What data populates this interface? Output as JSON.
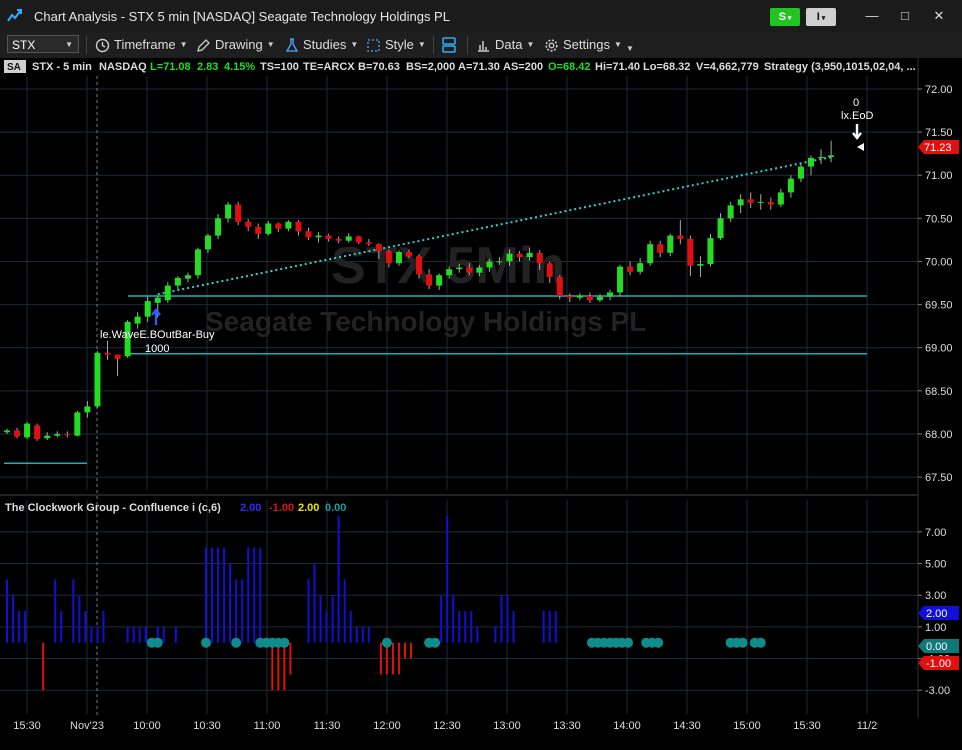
{
  "window": {
    "title": "Chart Analysis - STX 5 min [NASDAQ] Seagate Technology Holdings PL",
    "s_button": "S",
    "i_button": "I",
    "minimize": "—",
    "maximize": "□",
    "close": "✕"
  },
  "toolbar": {
    "symbol": "STX",
    "timeframe": "Timeframe",
    "drawing": "Drawing",
    "studies": "Studies",
    "style": "Style",
    "data": "Data",
    "settings": "Settings"
  },
  "status": {
    "badge": "SA",
    "symbol": "STX - 5 min",
    "exchange": "NASDAQ",
    "last": "L=71.08",
    "change": "2.83",
    "pct": "4.15%",
    "ts": "TS=100",
    "te": "TE=ARCX",
    "bid": "B=70.63",
    "bs": "BS=2,000",
    "ask": "A=71.30",
    "as": "AS=200",
    "open": "O=68.42",
    "high": "Hi=71.40",
    "low": "Lo=68.32",
    "volume": "V=4,662,779",
    "strategy": "Strategy (3,950,1015,02,04, ..."
  },
  "watermark": {
    "line1": "STX 5Min",
    "line2": "Seagate Technology Holdings PL"
  },
  "annotations": {
    "entry_label": "le.WaveE.BOutBar-Buy",
    "entry_qty": "1000",
    "exit_label": "lx.EoD",
    "exit_qty": "0",
    "last_price": "71.23"
  },
  "indicator": {
    "title": "The Clockwork Group - Confluence i (c,6)",
    "v1": "2.00",
    "v2": "-1.00",
    "v3": "2.00",
    "v4": "0.00",
    "tag_blue": "2.00",
    "tag_teal": "0.00",
    "tag_red": "-1.00"
  },
  "colors": {
    "up": "#22dd22",
    "down": "#e01010",
    "pos_bar": "#1010d8",
    "neg_bar": "#e01010",
    "dot": "#0f8c8c",
    "trendline": "#30d0d0",
    "hline": "#20b0b0"
  },
  "chart_data": [
    {
      "type": "candlestick",
      "yticks": [
        "72.00",
        "71.50",
        "71.00",
        "70.50",
        "70.00",
        "69.50",
        "69.00",
        "68.50",
        "68.00",
        "67.50"
      ],
      "ylim": [
        67.35,
        72.15
      ],
      "xticks": [
        "15:30",
        "Nov'23",
        "10:00",
        "10:30",
        "11:00",
        "11:30",
        "12:00",
        "12:30",
        "13:00",
        "13:30",
        "14:00",
        "14:30",
        "15:00",
        "15:30",
        "11/2"
      ],
      "candles": [
        [
          68.02,
          68.04,
          68.0,
          68.06
        ],
        [
          68.04,
          67.97,
          67.95,
          68.07
        ],
        [
          67.96,
          68.12,
          67.94,
          68.14
        ],
        [
          68.1,
          67.94,
          67.92,
          68.12
        ],
        [
          67.95,
          67.98,
          67.93,
          68.02
        ],
        [
          67.98,
          68.0,
          67.96,
          68.03
        ],
        [
          68.0,
          67.99,
          67.96,
          68.03
        ],
        [
          67.98,
          68.25,
          67.97,
          68.27
        ],
        [
          68.25,
          68.32,
          68.19,
          68.38
        ],
        [
          68.32,
          68.94,
          68.3,
          68.96
        ],
        [
          68.94,
          68.92,
          68.86,
          69.08
        ],
        [
          68.92,
          68.87,
          68.67,
          68.92
        ],
        [
          68.9,
          69.3,
          68.88,
          69.32
        ],
        [
          69.28,
          69.36,
          69.22,
          69.41
        ],
        [
          69.36,
          69.54,
          69.3,
          69.59
        ],
        [
          69.52,
          69.58,
          69.35,
          69.6
        ],
        [
          69.55,
          69.72,
          69.52,
          69.76
        ],
        [
          69.72,
          69.81,
          69.68,
          69.83
        ],
        [
          69.8,
          69.84,
          69.76,
          69.87
        ],
        [
          69.84,
          70.14,
          69.8,
          70.16
        ],
        [
          70.14,
          70.3,
          70.1,
          70.32
        ],
        [
          70.3,
          70.5,
          70.26,
          70.55
        ],
        [
          70.5,
          70.66,
          70.45,
          70.69
        ],
        [
          70.66,
          70.46,
          70.42,
          70.69
        ],
        [
          70.46,
          70.4,
          70.35,
          70.49
        ],
        [
          70.4,
          70.32,
          70.26,
          70.44
        ],
        [
          70.32,
          70.44,
          70.3,
          70.47
        ],
        [
          70.44,
          70.38,
          70.34,
          70.45
        ],
        [
          70.38,
          70.46,
          70.35,
          70.48
        ],
        [
          70.46,
          70.35,
          70.3,
          70.48
        ],
        [
          70.35,
          70.28,
          70.25,
          70.39
        ],
        [
          70.28,
          70.3,
          70.22,
          70.34
        ],
        [
          70.3,
          70.26,
          70.23,
          70.32
        ],
        [
          70.26,
          70.24,
          70.21,
          70.29
        ],
        [
          70.24,
          70.29,
          70.22,
          70.33
        ],
        [
          70.29,
          70.22,
          70.2,
          70.3
        ],
        [
          70.22,
          70.2,
          70.18,
          70.26
        ],
        [
          70.2,
          70.12,
          70.03,
          70.21
        ],
        [
          70.12,
          69.98,
          69.93,
          70.14
        ],
        [
          69.98,
          70.11,
          69.95,
          70.13
        ],
        [
          70.11,
          70.06,
          70.04,
          70.14
        ],
        [
          70.06,
          69.85,
          69.8,
          70.08
        ],
        [
          69.85,
          69.72,
          69.68,
          69.91
        ],
        [
          69.72,
          69.84,
          69.67,
          69.86
        ],
        [
          69.84,
          69.91,
          69.8,
          69.94
        ],
        [
          69.91,
          69.93,
          69.87,
          69.97
        ],
        [
          69.93,
          69.87,
          69.84,
          69.98
        ],
        [
          69.87,
          69.93,
          69.83,
          69.96
        ],
        [
          69.93,
          70.0,
          69.88,
          70.03
        ],
        [
          70.0,
          70.0,
          69.96,
          70.05
        ],
        [
          70.0,
          70.09,
          69.95,
          70.14
        ],
        [
          70.09,
          70.05,
          70.0,
          70.12
        ],
        [
          70.05,
          70.1,
          70.01,
          70.16
        ],
        [
          70.1,
          69.98,
          69.9,
          70.13
        ],
        [
          69.98,
          69.82,
          69.75,
          70.0
        ],
        [
          69.82,
          69.6,
          69.56,
          69.84
        ],
        [
          69.6,
          69.58,
          69.53,
          69.63
        ],
        [
          69.58,
          69.6,
          69.55,
          69.63
        ],
        [
          69.6,
          69.55,
          69.52,
          69.64
        ],
        [
          69.55,
          69.59,
          69.53,
          69.62
        ],
        [
          69.59,
          69.64,
          69.55,
          69.67
        ],
        [
          69.64,
          69.94,
          69.6,
          69.96
        ],
        [
          69.94,
          69.88,
          69.84,
          70.0
        ],
        [
          69.88,
          69.98,
          69.85,
          70.04
        ],
        [
          69.98,
          70.2,
          69.95,
          70.24
        ],
        [
          70.2,
          70.1,
          70.05,
          70.24
        ],
        [
          70.1,
          70.3,
          70.06,
          70.32
        ],
        [
          70.3,
          70.26,
          70.2,
          70.48
        ],
        [
          70.26,
          69.95,
          69.83,
          70.3
        ],
        [
          69.95,
          69.97,
          69.82,
          70.06
        ],
        [
          69.97,
          70.27,
          69.94,
          70.32
        ],
        [
          70.27,
          70.5,
          70.25,
          70.56
        ],
        [
          70.5,
          70.65,
          70.46,
          70.69
        ],
        [
          70.65,
          70.72,
          70.56,
          70.78
        ],
        [
          70.72,
          70.68,
          70.62,
          70.8
        ],
        [
          70.68,
          70.69,
          70.6,
          70.78
        ],
        [
          70.69,
          70.66,
          70.6,
          70.74
        ],
        [
          70.66,
          70.8,
          70.63,
          70.84
        ],
        [
          70.8,
          70.96,
          70.74,
          71.0
        ],
        [
          70.96,
          71.1,
          70.92,
          71.14
        ],
        [
          71.1,
          71.2,
          71.0,
          71.23
        ],
        [
          71.2,
          71.21,
          71.13,
          71.3
        ],
        [
          71.21,
          71.23,
          71.15,
          71.4
        ]
      ],
      "hlines": [
        69.6,
        68.93,
        67.66
      ],
      "trendline": {
        "from": [
          69.62,
          15
        ],
        "to": [
          71.21,
          82
        ]
      }
    },
    {
      "type": "bar",
      "yticks": [
        "7.00",
        "5.00",
        "3.00",
        "1.00",
        "-1.00",
        "-3.00"
      ],
      "ylim": [
        -4.5,
        8
      ],
      "values": [
        4,
        3,
        2,
        2,
        0,
        0,
        -3,
        0,
        4,
        2,
        0,
        4,
        3,
        2,
        1,
        1,
        2,
        0,
        0,
        0,
        1,
        1,
        1,
        1,
        0,
        1,
        1,
        0,
        1,
        0,
        0,
        0,
        0,
        6,
        6,
        6,
        6,
        5,
        4,
        4,
        6,
        6,
        6,
        0,
        -3,
        -3,
        -3,
        -2,
        0,
        0,
        4,
        5,
        3,
        2,
        3,
        8,
        4,
        2,
        1,
        1,
        1,
        0,
        -2,
        -2,
        -2,
        -2,
        -1,
        -1,
        0,
        0,
        0,
        0,
        3,
        8,
        3,
        2,
        2,
        2,
        1,
        0,
        0,
        1,
        3,
        3,
        2,
        0,
        0,
        0,
        0,
        2,
        2,
        2,
        0,
        0,
        0
      ],
      "dots": [
        24,
        25,
        33,
        38,
        42,
        43,
        44,
        45,
        46,
        63,
        70,
        71,
        97,
        98,
        99,
        100,
        101,
        102,
        103,
        106,
        107,
        108,
        120,
        121,
        122,
        124,
        125
      ]
    }
  ]
}
